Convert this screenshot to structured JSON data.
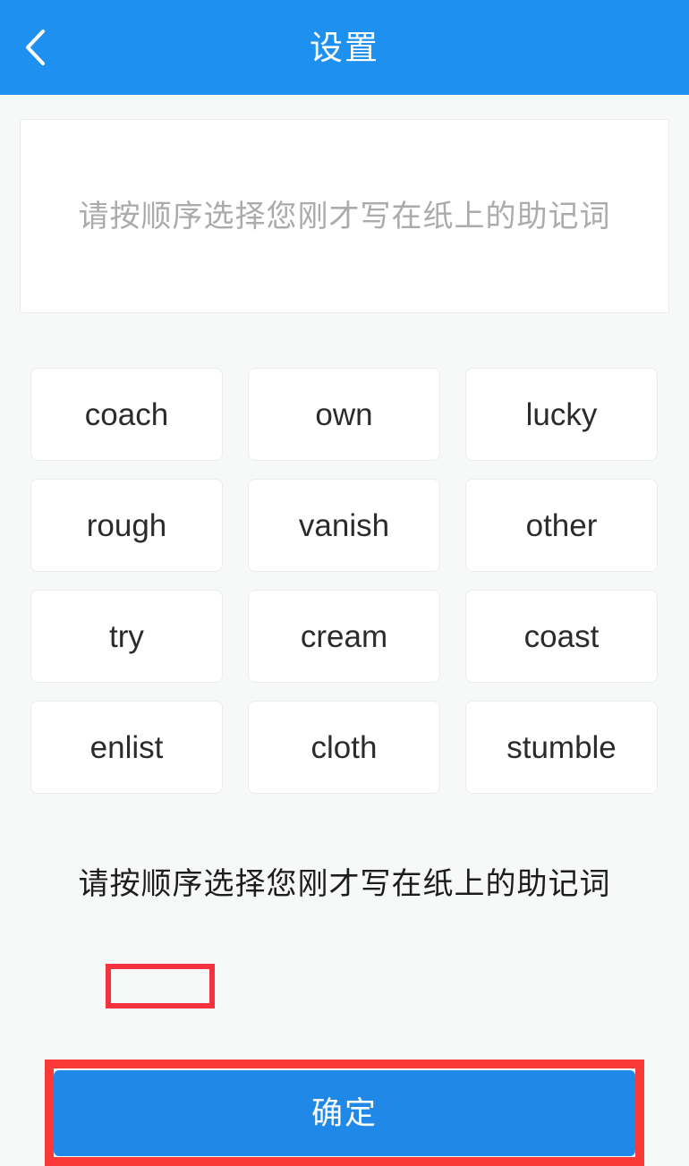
{
  "header": {
    "title": "设置",
    "back_icon": "chevron-left-icon",
    "background_color": "#1e90f0"
  },
  "mnemonic_input": {
    "placeholder": "请按顺序选择您刚才写在纸上的助记词",
    "value": ""
  },
  "word_grid": {
    "words": [
      "coach",
      "own",
      "lucky",
      "rough",
      "vanish",
      "other",
      "try",
      "cream",
      "coast",
      "enlist",
      "cloth",
      "stumble"
    ]
  },
  "hint": {
    "text": "请按顺序选择您刚才写在纸上的助记词",
    "highlighted_fragment": "按顺序"
  },
  "confirm": {
    "label": "确定",
    "background_color": "#2089e8"
  },
  "annotations": {
    "color": "#f5333f",
    "targets": [
      "hint-highlight",
      "confirm-button"
    ]
  }
}
